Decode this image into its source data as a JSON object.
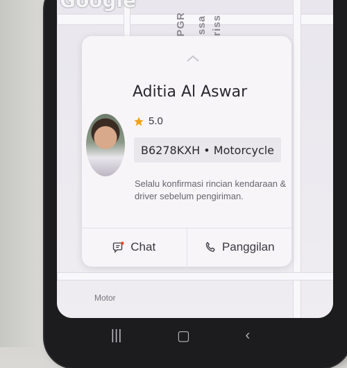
{
  "map": {
    "logo": "Google",
    "street_1": "g PGR",
    "street_2": "Crissa",
    "street_3": "l.Criss",
    "bottom_label": "Motor"
  },
  "driver": {
    "name": "Aditia Al Aswar",
    "rating": "5.0",
    "vehicle": "B6278KXH • Motorcycle",
    "note": "Selalu konfirmasi rincian kendaraan & driver sebelum pengiriman."
  },
  "actions": {
    "chat_label": "Chat",
    "call_label": "Panggilan"
  },
  "colors": {
    "star": "#f2a31a",
    "chat_dot": "#e0452b",
    "card_bg": "#f7f5f8"
  },
  "icons": {
    "star": "star-icon",
    "chat": "chat-icon",
    "phone": "phone-icon",
    "expand": "chevron-up-icon"
  }
}
